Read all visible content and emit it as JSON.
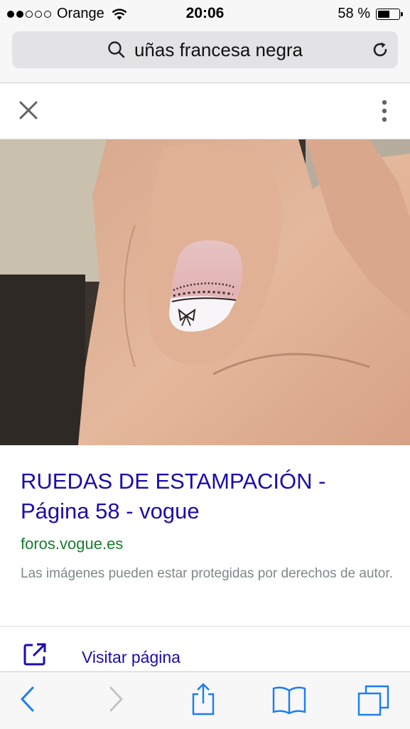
{
  "status_bar": {
    "carrier": "Orange",
    "signal_bars_filled": 2,
    "signal_bars_total": 5,
    "time": "20:06",
    "battery_percent": "58 %",
    "battery_level": 0.58
  },
  "address_bar": {
    "query": "uñas francesa negra",
    "search_icon": "search-icon",
    "reload_icon": "reload-icon"
  },
  "viewer": {
    "close_icon": "close-icon",
    "more_icon": "more-vertical-icon"
  },
  "result": {
    "title": "RUEDAS DE ESTAMPACIÓN - Página 58 - vogue",
    "domain": "foros.vogue.es",
    "notice": "Las imágenes pueden estar protegidas por derechos de autor.",
    "visit_label": "Visitar página",
    "visit_icon": "open-external-icon"
  },
  "bottom_toolbar": {
    "icons": [
      "back-icon",
      "forward-icon",
      "share-icon",
      "bookmarks-icon",
      "tabs-icon"
    ]
  },
  "colors": {
    "link": "#1a0dab",
    "domain": "#1a7b2e",
    "ios_blue": "#1a7cf5",
    "disabled": "#c4c4c8"
  }
}
